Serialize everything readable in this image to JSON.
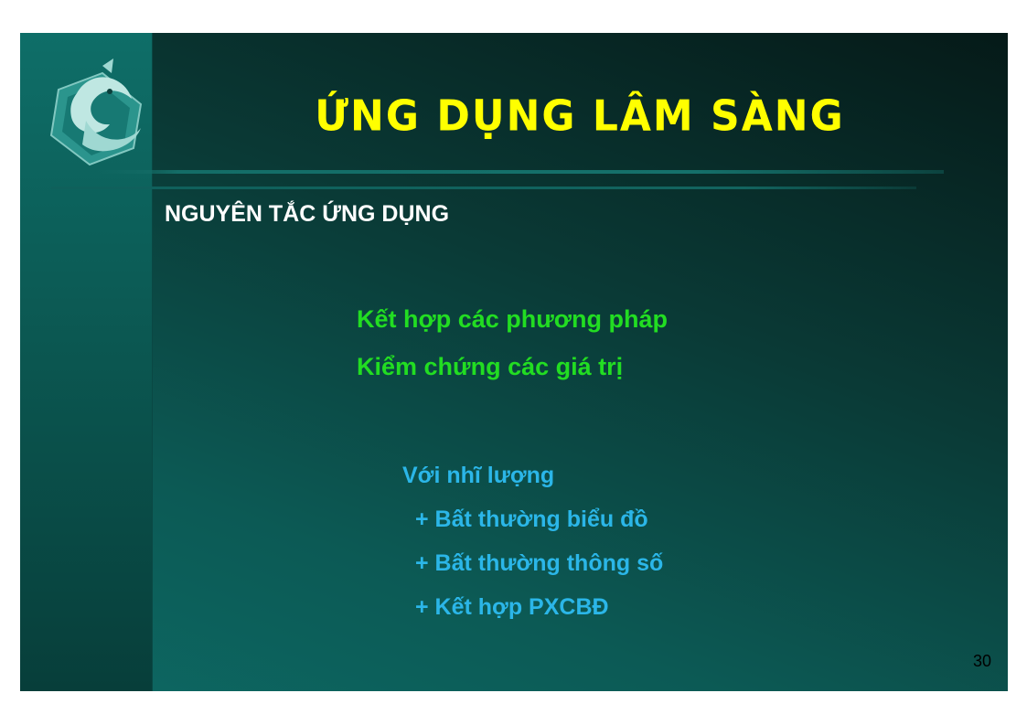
{
  "slide": {
    "title": "ỨNG DỤNG LÂM SÀNG",
    "subtitle": "NGUYÊN TẮC ỨNG DỤNG",
    "principles": [
      "Kết hợp các phương pháp",
      "Kiểm chứng các giá trị"
    ],
    "detail_heading": "Với nhĩ lượng",
    "detail_items": [
      "+ Bất thường biểu đồ",
      "+ Bất thường thông số",
      "+ Kết hợp PXCBĐ"
    ],
    "page_number": "30"
  },
  "colors": {
    "title": "#ffff00",
    "subtitle": "#ffffff",
    "principles": "#22dd22",
    "details": "#2bb6e8",
    "background_dark": "#051a18",
    "background_light": "#0d6863"
  },
  "icons": {
    "logo": "dolphin-logo-icon"
  }
}
